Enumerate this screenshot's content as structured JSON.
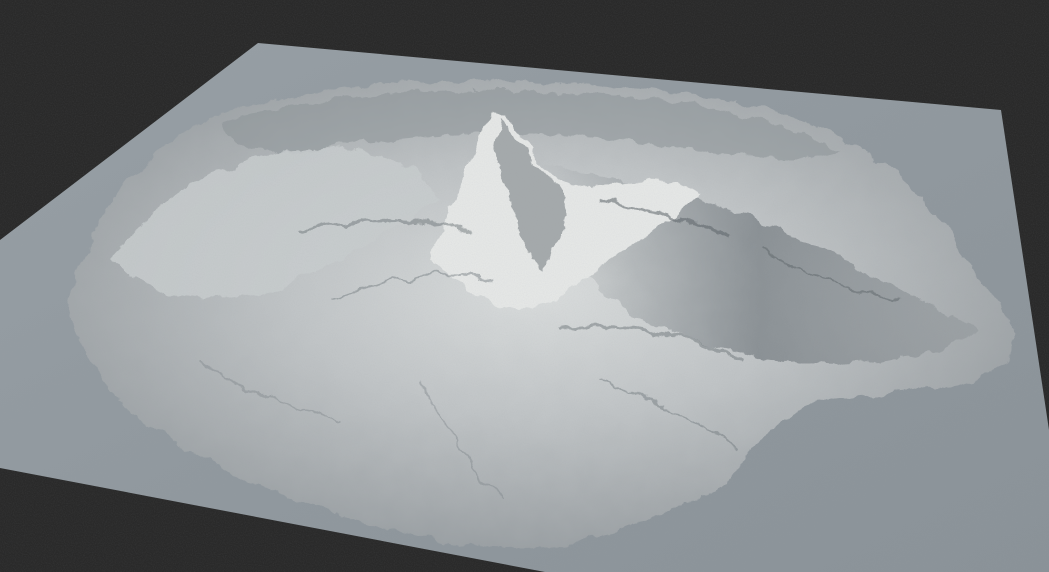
{
  "viewport": {
    "background_color": "#2a2a2a",
    "ground_plane_color": "#8f979e",
    "terrain_light_color": "#d9dcdc",
    "terrain_mid_color": "#a9aeb1",
    "terrain_shadow_color": "#5f676d"
  }
}
